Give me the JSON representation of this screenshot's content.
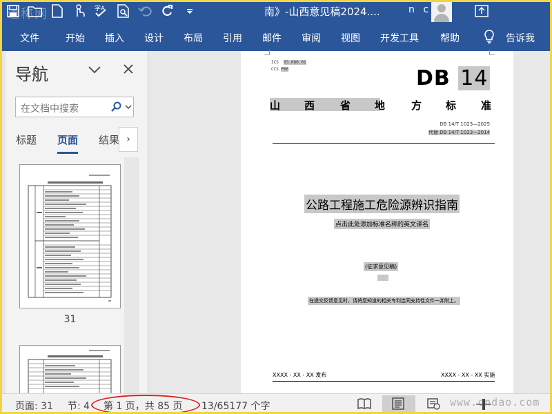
{
  "titlebar": {
    "watermark": "道称网",
    "document_title": "南》-山西意见稿2024....",
    "user_name": "n c"
  },
  "menu": {
    "items": [
      "文件",
      "开始",
      "插入",
      "设计",
      "布局",
      "引用",
      "邮件",
      "审阅",
      "视图",
      "开发工具",
      "帮助"
    ],
    "tell_me": "告诉我"
  },
  "navigation": {
    "title": "导航",
    "search_placeholder": "在文档中搜索",
    "tabs": [
      "标题",
      "页面",
      "结果"
    ],
    "active_tab": "页面",
    "thumbnail_label": "31"
  },
  "page": {
    "ics_label": "ICS",
    "ics_value": "93.080.01",
    "ccs_label": "CCS",
    "ccs_value": "P66",
    "db_prefix": "DB",
    "db_number": "14",
    "province_chars": [
      "山",
      "西",
      "省",
      "地",
      "方",
      "标",
      "准"
    ],
    "code_line": "DB 14/T 1023—2025",
    "replace_line": "代替 DB 14/T 1023—2014",
    "title": "公路工程施工危险源辨识指南",
    "english_prompt": "点击此处添加标准名称的英文译名",
    "draft_label": "(征求意见稿)",
    "notice": "在提交反馈意见时，请将您知道的相关专利连同支持性文件一并附上。",
    "issue_date": "XXXX - XX - XX 发布",
    "impl_date": "XXXX - XX - XX 实施"
  },
  "statusbar": {
    "page": "页面: 31",
    "section": "节: 4",
    "page_of": "第 1 页，共 85 页",
    "words": "13/65177 个字",
    "watermark": "www.cndao.com"
  },
  "colors": {
    "ribbon": "#2b579a",
    "highlight": "#c8c8c8",
    "annotation": "#e02020"
  }
}
